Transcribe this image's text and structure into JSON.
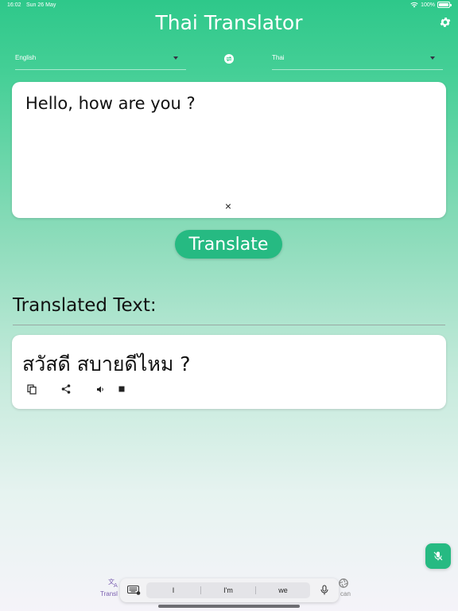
{
  "status_bar": {
    "time": "16:02",
    "date": "Sun 26 May",
    "battery": "100%"
  },
  "header": {
    "title": "Thai Translator",
    "settings_icon": "gear-icon"
  },
  "languages": {
    "source": "English",
    "target": "Thai",
    "swap_icon": "swap-icon"
  },
  "input": {
    "text": "Hello, how are you ?",
    "clear_symbol": "×"
  },
  "translate_button": {
    "label": "Translate"
  },
  "result": {
    "heading": "Translated Text:",
    "text": "สวัสดี สบายดีไหม ?",
    "actions": [
      "copy-icon",
      "share-icon",
      "speaker-icon",
      "stop-icon"
    ]
  },
  "fab": {
    "icon": "microphone-off-icon"
  },
  "bottom_nav": {
    "tabs": [
      {
        "label": "Transl",
        "icon": "translate-icon"
      },
      {
        "label": "can",
        "icon": "camera-shutter-icon"
      }
    ]
  },
  "keyboard": {
    "suggestions": [
      "I",
      "I'm",
      "we"
    ]
  },
  "colors": {
    "accent": "#26ba82",
    "header_gradient_top": "#2ec88a",
    "background_bottom": "#f5f3f9"
  }
}
